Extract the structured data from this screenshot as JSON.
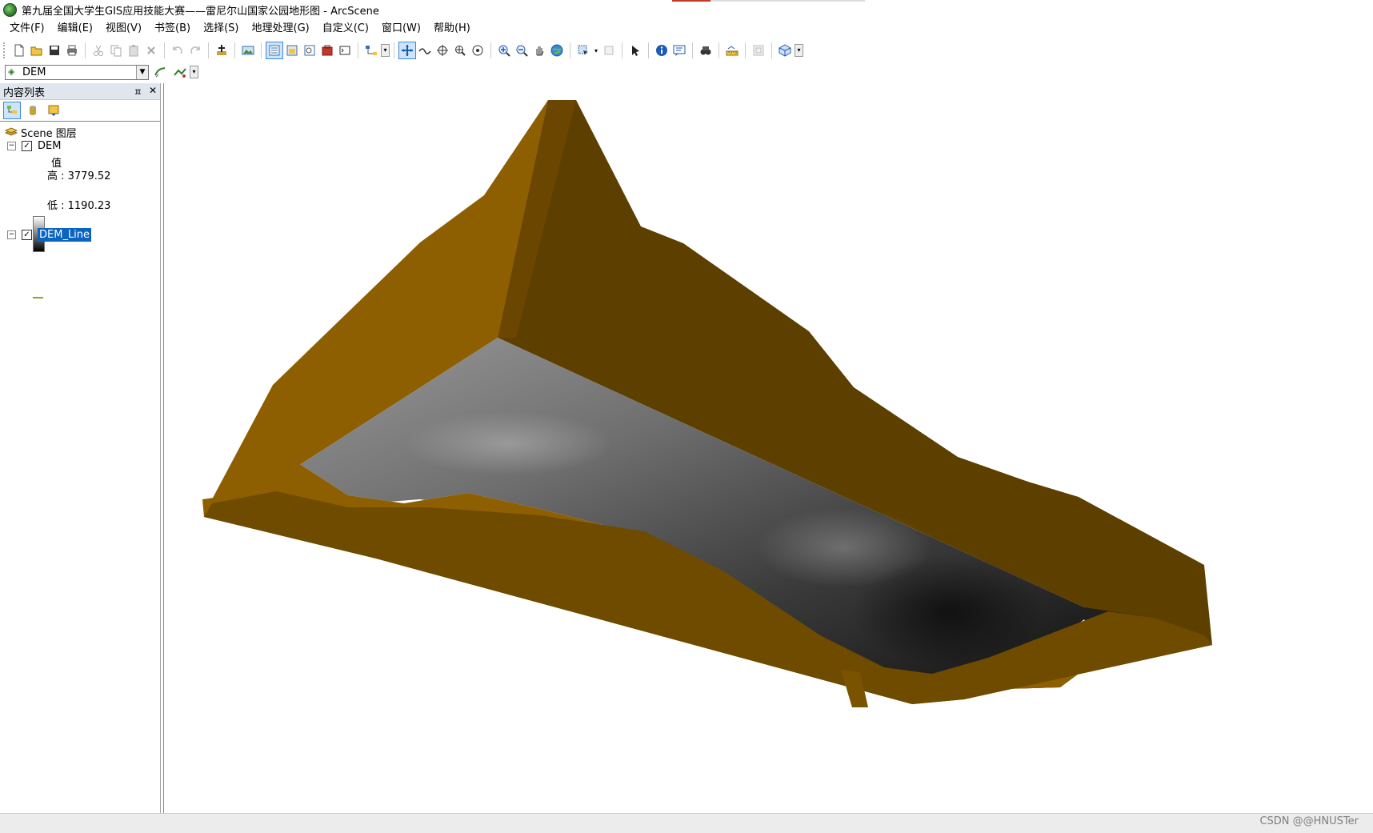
{
  "window": {
    "title": "第九届全国大学生GIS应用技能大赛——雷尼尔山国家公园地形图 - ArcScene"
  },
  "menu": [
    "文件(F)",
    "编辑(E)",
    "视图(V)",
    "书签(B)",
    "选择(S)",
    "地理处理(G)",
    "自定义(C)",
    "窗口(W)",
    "帮助(H)"
  ],
  "toolbar2": {
    "layer_value": "DEM"
  },
  "toc": {
    "title": "内容列表",
    "pin": "ㅍ",
    "close": "✕",
    "scene_label": "Scene 图层",
    "dem": {
      "name": "DEM",
      "value_label": "值",
      "high": "高 : 3779.52",
      "low": "低 : 1190.23"
    },
    "dem_line": {
      "name": "DEM_Line"
    }
  },
  "watermark": "CSDN @@HNUSTer",
  "colors": {
    "wall_light": "#8e5f00",
    "wall_dark": "#5d3f00",
    "selection": "#0a64c2",
    "legend_line": "#9b9b27"
  },
  "icons": {
    "toolbar1": [
      "new-file-icon",
      "open-folder-icon",
      "save-icon",
      "print-icon",
      "cut-icon",
      "copy-icon",
      "paste-icon",
      "delete-icon",
      "undo-icon",
      "redo-icon",
      "add-data-icon",
      "scene-properties-icon",
      "table-of-contents-icon",
      "arctoolbox-icon",
      "catalog-icon",
      "search-window-icon",
      "python-icon",
      "model-builder-icon",
      "navigate-icon",
      "fly-icon",
      "target-center-icon",
      "zoom-to-target-icon",
      "set-observer-icon",
      "zoom-in-icon",
      "zoom-out-icon",
      "pan-icon",
      "full-extent-icon",
      "select-features-icon",
      "clear-selection-icon",
      "select-elements-icon",
      "identify-icon",
      "html-popup-icon",
      "find-icon",
      "measure-icon",
      "narrow-fov-icon",
      "3d-effects-icon"
    ],
    "toolbar2": [
      "interpolate-line-icon",
      "interpolate-point-icon"
    ]
  }
}
